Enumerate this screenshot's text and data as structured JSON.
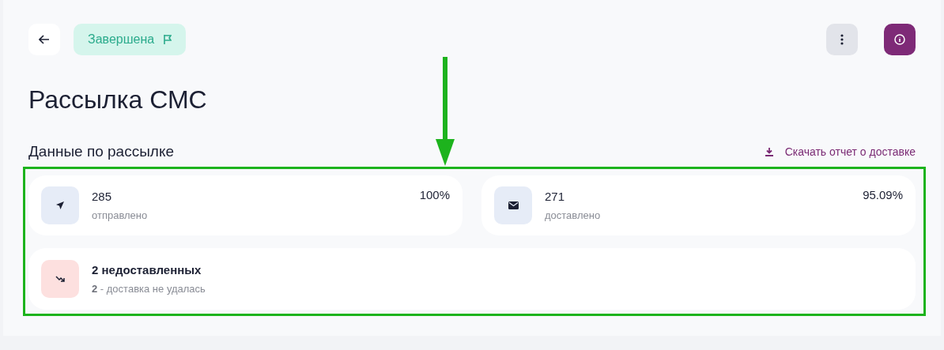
{
  "header": {
    "status": {
      "label": "Завершена"
    }
  },
  "title": "Рассылка СМС",
  "section": {
    "heading": "Данные по рассылке",
    "download_link": "Скачать отчет о доставке"
  },
  "stats": [
    {
      "kind": "sent",
      "value": "285",
      "label": "отправлено",
      "percent": "100%"
    },
    {
      "kind": "delivered",
      "value": "271",
      "label": "доставлено",
      "percent": "95.09%"
    }
  ],
  "failed": {
    "title": "2 недоставленных",
    "detail": "**2** - доставка не удалась"
  }
}
